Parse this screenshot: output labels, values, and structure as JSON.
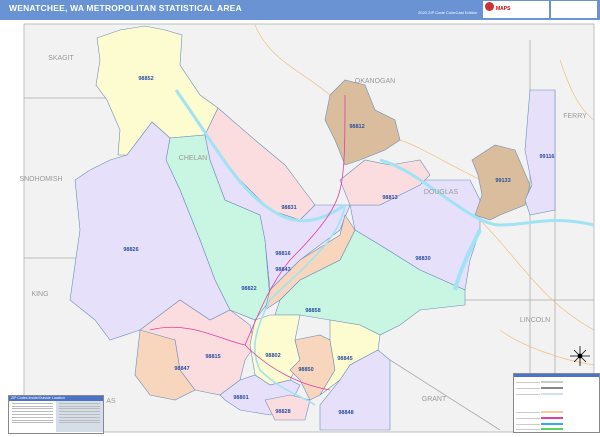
{
  "header": {
    "title": "WENATCHEE, WA METROPOLITAN STATISTICAL AREA",
    "edition": "2020 ZIP Code ColorCast Edition",
    "logo_text": "MAPS"
  },
  "counties": [
    "SKAGIT",
    "SNOHOMISH",
    "KING",
    "CHELAN",
    "OKANOGAN",
    "DOUGLAS",
    "FERRY",
    "LINCOLN",
    "GRANT",
    "AS"
  ],
  "zip_codes": [
    "98852",
    "98831",
    "98822",
    "98826",
    "98816",
    "98843",
    "98858",
    "98830",
    "98813",
    "98812",
    "99133",
    "99116",
    "98815",
    "98847",
    "98802",
    "98850",
    "98845",
    "98801",
    "98828",
    "98848"
  ],
  "colors": {
    "yellow": "#fdfbd0",
    "pink": "#fbdde0",
    "green": "#c9f5e3",
    "purple": "#e6e0fb",
    "tan": "#d9bd9c",
    "orange": "#f8d5bd",
    "water": "#9fe3f5",
    "background": "#f2f2f2",
    "header": "#6a93d4"
  },
  "legend_left": {
    "title": "ZIP Codes Inside/Outside Location"
  },
  "legend_right": {
    "title": "Map Legend"
  }
}
